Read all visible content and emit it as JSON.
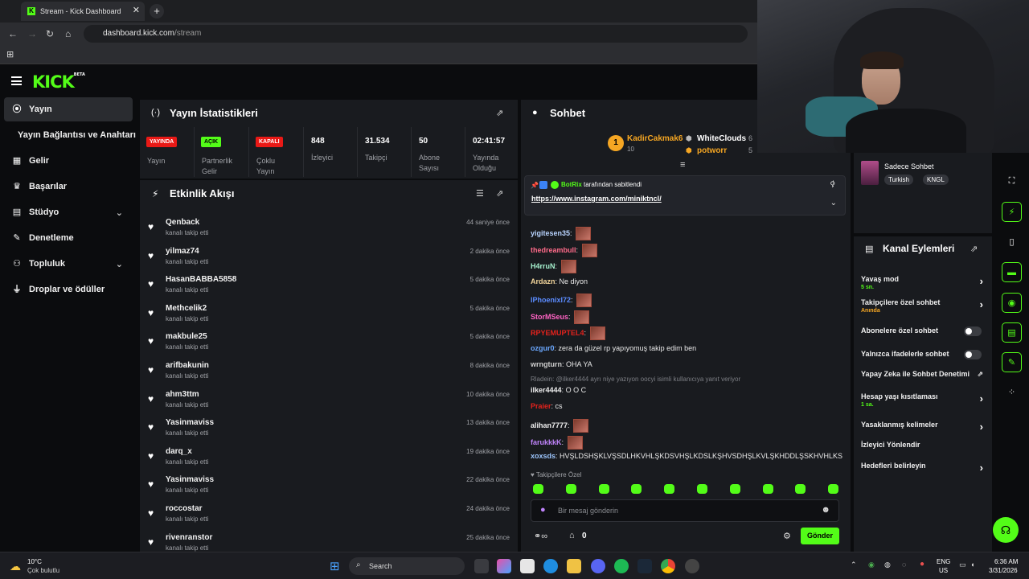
{
  "browser": {
    "tab_title": "Stream - Kick Dashboard",
    "url_host": "dashboard.kick.com",
    "url_path": "/stream"
  },
  "header": {
    "logo": "KICK",
    "logo_tag": "BETA"
  },
  "sidebar": {
    "items": [
      {
        "label": "Yayın",
        "icon": "signal-icon"
      },
      {
        "label": "Yayın Bağlantısı ve Anahtarı",
        "icon": ""
      },
      {
        "label": "Gelir",
        "icon": "revenue-icon"
      },
      {
        "label": "Başarılar",
        "icon": "trophy-icon"
      },
      {
        "label": "Stüdyo",
        "icon": "studio-icon"
      },
      {
        "label": "Denetleme",
        "icon": "wrench-icon"
      },
      {
        "label": "Topluluk",
        "icon": "community-icon"
      },
      {
        "label": "Droplar ve ödüller",
        "icon": "drops-icon"
      }
    ]
  },
  "stats": {
    "title": "Yayın İstatistikleri",
    "items": [
      {
        "badge": "YAYINDA",
        "label": "Yayın",
        "badge_color": "#e91916"
      },
      {
        "badge": "AÇIK",
        "label": "Partnerlik Gelir",
        "badge_color": "#53fc18"
      },
      {
        "badge": "KAPALI",
        "label": "Çoklu Yayın",
        "badge_color": "#e91916"
      },
      {
        "value": "848",
        "label": "İzleyici"
      },
      {
        "value": "31.534",
        "label": "Takipçi"
      },
      {
        "value": "50",
        "label": "Abone Sayısı"
      },
      {
        "value": "02:41:57",
        "label": "Yayında Olduğu Sü..."
      }
    ]
  },
  "activity": {
    "title": "Etkinlik Akışı",
    "items": [
      {
        "name": "Qenback",
        "action": "kanalı takip etti",
        "time": "44 saniye önce"
      },
      {
        "name": "yilmaz74",
        "action": "kanalı takip etti",
        "time": "2 dakika önce"
      },
      {
        "name": "HasanBABBA5858",
        "action": "kanalı takip etti",
        "time": "5 dakika önce"
      },
      {
        "name": "Methcelik2",
        "action": "kanalı takip etti",
        "time": "5 dakika önce"
      },
      {
        "name": "makbule25",
        "action": "kanalı takip etti",
        "time": "5 dakika önce"
      },
      {
        "name": "arifbakunin",
        "action": "kanalı takip etti",
        "time": "8 dakika önce"
      },
      {
        "name": "ahm3ttm",
        "action": "kanalı takip etti",
        "time": "10 dakika önce"
      },
      {
        "name": "Yasinmaviss",
        "action": "kanalı takip etti",
        "time": "13 dakika önce"
      },
      {
        "name": "darq_x",
        "action": "kanalı takip etti",
        "time": "19 dakika önce"
      },
      {
        "name": "Yasinmaviss",
        "action": "kanalı takip etti",
        "time": "22 dakika önce"
      },
      {
        "name": "roccostar",
        "action": "kanalı takip etti",
        "time": "24 dakika önce"
      },
      {
        "name": "rivenranstor",
        "action": "kanalı takip etti",
        "time": "25 dakika önce"
      }
    ]
  },
  "chat": {
    "title": "Sohbet",
    "top_gifters": [
      {
        "rank": "1",
        "name": "KadirCakmak6",
        "count": "10"
      },
      {
        "name": "WhiteClouds",
        "count": "6"
      },
      {
        "name": "potworr",
        "count": "5"
      }
    ],
    "pinned": {
      "by": "BotRix",
      "by_text": "tarafından sabitlendi",
      "link": "https://www.instagram.com/miniktncl/"
    },
    "messages": [
      {
        "user": "yigitesen35",
        "text": "",
        "color": "#b9d4ff",
        "emote": true
      },
      {
        "user": "thedreambull",
        "text": "",
        "color": "#ff6b8a",
        "emote": true
      },
      {
        "user": "H4rruN",
        "text": "",
        "color": "#a7f3d0",
        "emote": true
      },
      {
        "user": "Ardazn",
        "text": "Ne diyon",
        "color": "#f2d59b",
        "emote": false
      },
      {
        "user": "IPhoenixI72",
        "text": "",
        "color": "#5b8cff",
        "emote": true
      },
      {
        "user": "StorMSeus",
        "text": "",
        "color": "#ff63c4",
        "emote": true
      },
      {
        "user": "RPYEMUPTEL4",
        "text": "",
        "color": "#e3221c",
        "emote": true
      },
      {
        "user": "ozgur0",
        "text": "zera da güzel rp yapıyomuş takip edim ben",
        "color": "#6ba8ff",
        "emote": false
      },
      {
        "user": "wrngturn",
        "text": "OHA YA",
        "color": "#cfcfcf",
        "emote": false
      },
      {
        "user": "ilker4444",
        "text": "O O C",
        "color": "#f0f0f0",
        "emote": false
      },
      {
        "user": "Praier",
        "text": "cs",
        "color": "#e3221c",
        "emote": false
      },
      {
        "user": "alihan7777",
        "text": "",
        "color": "#f0f0f0",
        "emote": true
      },
      {
        "user": "farukkkK",
        "text": "",
        "color": "#c084fc",
        "emote": true
      },
      {
        "user": "xoxsds",
        "text": "HVŞLDSHŞKLVŞSDLHKVHLŞKDSVHŞLKDSLKŞHVSDHŞLKVLŞKHDDLŞSKHVHLKS",
        "color": "#9ec7ff",
        "emote": false
      }
    ],
    "reply_hint": "Rladein: @ilker4444 ayrı niye yazıyon oocyi isimli kullanıcıya yanıt veriyor",
    "followers_only": "Takipçilere Özel",
    "input_placeholder": "Bir mesaj gönderin",
    "count": "0",
    "send_label": "Gönder"
  },
  "channel_actions": {
    "title": "Kanal Eylemleri",
    "mode_label": "Sadece Sohbet",
    "tags": [
      "Turkish",
      "KNGL"
    ],
    "items": [
      {
        "label": "Yavaş mod",
        "sub": "5 sn."
      },
      {
        "label": "Takipçilere özel sohbet",
        "sub": "Anında"
      },
      {
        "label": "Abonelere özel sohbet",
        "sub": ""
      },
      {
        "label": "Yalnızca ifadelerle sohbet",
        "sub": ""
      },
      {
        "label": "Yapay Zeka ile Sohbet Denetimi",
        "sub": ""
      },
      {
        "label": "Hesap yaşı kısıtlaması",
        "sub": "1 sa."
      },
      {
        "label": "Yasaklanmış kelimeler",
        "sub": ""
      },
      {
        "label": "İzleyici Yönlendir",
        "sub": ""
      },
      {
        "label": "Hedefleri belirleyin",
        "sub": ""
      }
    ]
  },
  "taskbar": {
    "temp": "10°C",
    "weather": "Çok bulutlu",
    "search": "Search",
    "lang": "ENG",
    "region": "US",
    "time": "6:36 AM",
    "date": "3/31/2026"
  },
  "colors": {
    "accent": "#53fc18",
    "live": "#e91916",
    "panel": "#191b1f"
  }
}
